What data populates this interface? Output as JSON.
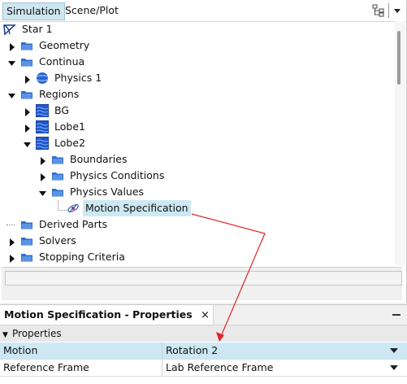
{
  "tabs": [
    "Simulation",
    "Scene/Plot"
  ],
  "tree": [
    {
      "label": "Star 1",
      "icon": "sim-icon",
      "level": 0,
      "twisty": "none"
    },
    {
      "label": "Geometry",
      "icon": "folder-icon",
      "level": 1,
      "twisty": "collapsed"
    },
    {
      "label": "Continua",
      "icon": "folder-icon",
      "level": 1,
      "twisty": "expanded"
    },
    {
      "label": "Physics 1",
      "icon": "physics-icon",
      "level": 2,
      "twisty": "collapsed"
    },
    {
      "label": "Regions",
      "icon": "folder-icon",
      "level": 1,
      "twisty": "expanded"
    },
    {
      "label": "BG",
      "icon": "region-icon",
      "level": 2,
      "twisty": "collapsed"
    },
    {
      "label": "Lobe1",
      "icon": "region-icon",
      "level": 2,
      "twisty": "collapsed"
    },
    {
      "label": "Lobe2",
      "icon": "region-icon",
      "level": 2,
      "twisty": "expanded"
    },
    {
      "label": "Boundaries",
      "icon": "folder-icon",
      "level": 3,
      "twisty": "collapsed"
    },
    {
      "label": "Physics Conditions",
      "icon": "folder-icon",
      "level": 3,
      "twisty": "collapsed"
    },
    {
      "label": "Physics Values",
      "icon": "folder-icon",
      "level": 3,
      "twisty": "expanded"
    },
    {
      "label": "Motion Specification",
      "icon": "motion-icon",
      "level": 4,
      "twisty": "leaf",
      "selected": true
    },
    {
      "label": "Derived Parts",
      "icon": "folder-icon",
      "level": 1,
      "twisty": "leaf"
    },
    {
      "label": "Solvers",
      "icon": "folder-icon",
      "level": 1,
      "twisty": "collapsed"
    },
    {
      "label": "Stopping Criteria",
      "icon": "folder-icon",
      "level": 1,
      "twisty": "collapsed"
    }
  ],
  "properties": {
    "title": "Motion Specification - Properties",
    "close_glyph": "×",
    "section": "Properties",
    "rows": [
      {
        "name": "Motion",
        "value": "Rotation 2"
      },
      {
        "name": "Reference Frame",
        "value": "Lab Reference Frame"
      }
    ]
  },
  "colors": {
    "folder": "#2f6fcf",
    "region": "#2056c8",
    "selection": "#cde8f3",
    "annotation_arrow": "#e0242a"
  }
}
